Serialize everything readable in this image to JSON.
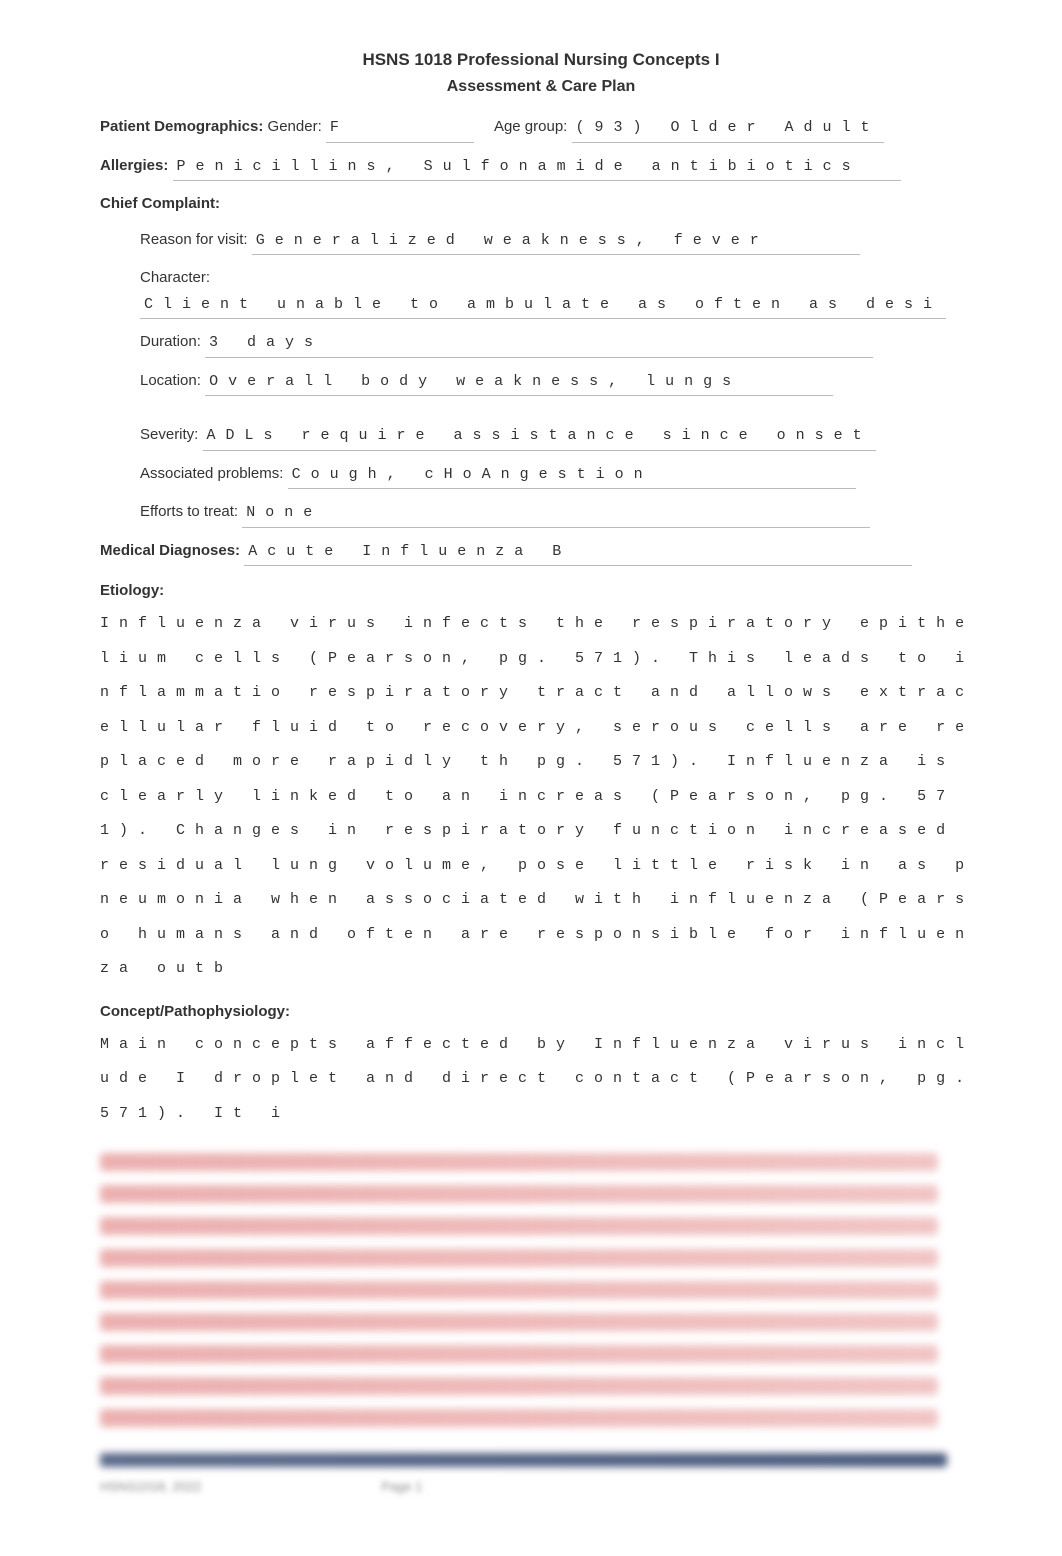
{
  "title": "HSNS 1018 Professional Nursing Concepts I",
  "subtitle": "Assessment & Care Plan",
  "demographics": {
    "label": "Patient Demographics",
    "gender_label": "Gender:",
    "gender": "F",
    "age_label": "Age group:",
    "age": "(93) Older Adult"
  },
  "allergies": {
    "label": "Allergies",
    "value": "Penicillins, Sulfonamide antibiotics"
  },
  "chief_complaint": {
    "label": "Chief Complaint",
    "reason_label": "Reason for visit:",
    "reason": "Generalized weakness, fever",
    "character_label": "Character:",
    "character": "Client unable to ambulate as often as desi",
    "duration_label": "Duration:",
    "duration": "3 days",
    "location_label": "Location:",
    "location": "Overall body weakness, lungs",
    "severity_label": "Severity:",
    "severity": "ADLs require assistance since onset",
    "assoc_label": "Associated problems:",
    "assoc": "Cough, cHoAngestion",
    "efforts_label": "Efforts to treat:",
    "efforts": "None"
  },
  "diagnoses": {
    "label": "Medical Diagnoses",
    "value": "Acute Influenza B"
  },
  "etiology": {
    "label": "Etiology",
    "text": "Influenza virus infects the respiratory epithelium cells (Pearson, pg. 571). This leads to inflammatio respiratory tract and allows extracellular fluid to recovery, serous cells are replaced more rapidly th pg. 571). Influenza is clearly linked to an increas (Pearson, pg. 571). Changes in respiratory function increased residual lung volume, pose little risk in as pneumonia when associated with influenza (Pearso humans and often are responsible for influenza outb"
  },
  "concept": {
    "label": "Concept/Pathophysiology",
    "text": "Main concepts affected by Influenza virus include I droplet and direct contact (Pearson, pg. 571). It i"
  },
  "footer": {
    "left": "HSNS1018, 2022",
    "right": "Page 1"
  }
}
